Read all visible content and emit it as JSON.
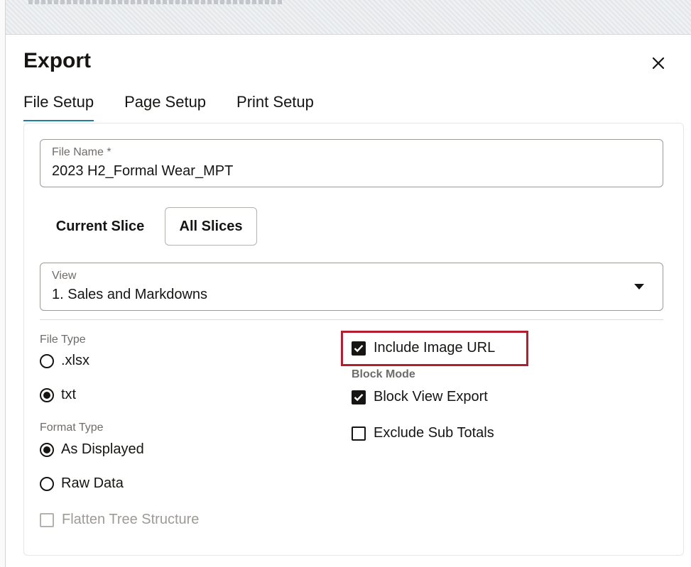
{
  "dialog": {
    "title": "Export",
    "tabs": [
      {
        "label": "File Setup",
        "active": true
      },
      {
        "label": "Page Setup",
        "active": false
      },
      {
        "label": "Print Setup",
        "active": false
      }
    ]
  },
  "file_name": {
    "label": "File Name *",
    "value": "2023 H2_Formal Wear_MPT"
  },
  "slice": {
    "options": [
      "Current Slice",
      "All Slices"
    ],
    "selected": "All Slices"
  },
  "view": {
    "label": "View",
    "value": "1. Sales and Markdowns"
  },
  "file_type": {
    "label": "File Type",
    "options": [
      {
        "label": ".xlsx",
        "selected": false
      },
      {
        "label": "txt",
        "selected": true
      }
    ]
  },
  "format_type": {
    "label": "Format Type",
    "options": [
      {
        "label": "As Displayed",
        "selected": true
      },
      {
        "label": "Raw Data",
        "selected": false
      }
    ]
  },
  "flatten": {
    "label": "Flatten Tree Structure",
    "checked": false,
    "disabled": true
  },
  "include_image_url": {
    "label": "Include Image URL",
    "checked": true
  },
  "block_mode": {
    "label": "Block Mode",
    "options": [
      {
        "label": "Block View Export",
        "checked": true
      },
      {
        "label": "Exclude Sub Totals",
        "checked": false
      }
    ]
  },
  "colors": {
    "tab_underline": "#227e9e",
    "highlight_border": "#b01e2f",
    "text": "#161513",
    "muted": "#6f6c69"
  },
  "icons": [
    "close-icon",
    "chevron-down-icon",
    "radio-selected-icon",
    "radio-unselected-icon",
    "checkbox-checked-icon",
    "checkbox-unchecked-icon"
  ]
}
